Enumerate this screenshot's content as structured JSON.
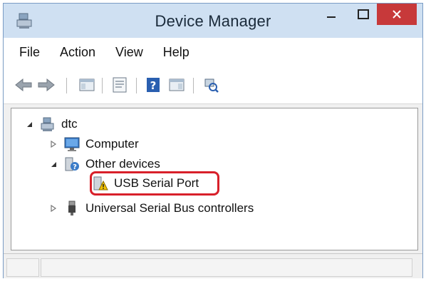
{
  "window": {
    "title": "Device Manager"
  },
  "menu": [
    "File",
    "Action",
    "View",
    "Help"
  ],
  "toolbar": {
    "buttons": [
      "back-icon",
      "forward-icon",
      "show-hide-console-tree-icon",
      "properties-icon",
      "help-icon",
      "show-action-pane-icon",
      "scan-hardware-changes-icon"
    ]
  },
  "tree": {
    "root": {
      "label": "dtc",
      "icon": "computer-tree-icon"
    },
    "computer": {
      "label": "Computer",
      "icon": "monitor-icon"
    },
    "other_devices": {
      "label": "Other devices",
      "icon": "unknown-device-icon"
    },
    "usb_serial_port": {
      "label": "USB Serial Port",
      "icon": "warning-device-icon"
    },
    "usb_controllers": {
      "label": "Universal Serial Bus controllers",
      "icon": "usb-plug-icon"
    }
  },
  "colors": {
    "highlight": "#d8202a",
    "close_button": "#c7393a",
    "titlebar": "#cfe0f2"
  }
}
